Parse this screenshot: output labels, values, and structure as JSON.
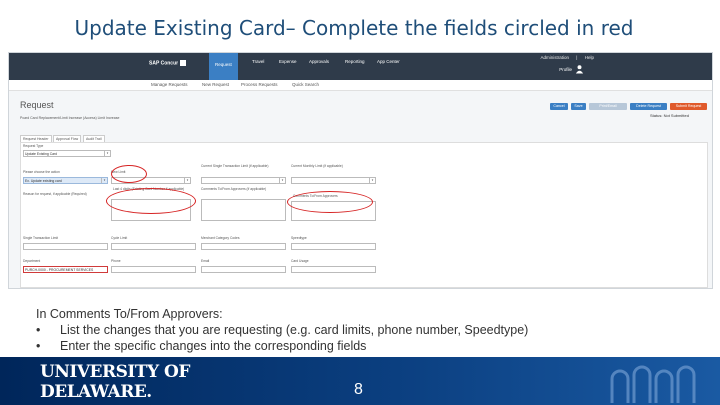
{
  "slide": {
    "title": "Update Existing Card– Complete the fields circled in red",
    "page_number": "8"
  },
  "sap": {
    "util_links": [
      "Administration",
      "|",
      "Help"
    ],
    "profile": "Profile",
    "logo_text": "SAP Concur",
    "nav": [
      "Request",
      "Travel",
      "Expense",
      "Approvals",
      "Reporting",
      "App Center"
    ],
    "subnav": [
      "Manage Requests",
      "New Request",
      "Process Requests",
      "Quick Search"
    ],
    "request_title": "Request",
    "request_sub": "Pcard Card Replacement/Limit Increase (Access) Limit Increase",
    "buttons": [
      {
        "label": "Cancel",
        "color": "#3b7fc4"
      },
      {
        "label": "Save",
        "color": "#3b7fc4"
      },
      {
        "label": "Print/Email",
        "color": "#b7c7d8"
      },
      {
        "label": "Delete Request",
        "color": "#3b7fc4"
      },
      {
        "label": "Submit Request",
        "color": "#e05a2b"
      }
    ],
    "status_label": "Status:",
    "status_value": "Not Submitted",
    "tabs": [
      "Request Header",
      "Approval Flow",
      "Audit Trail"
    ],
    "fields": {
      "request_type_label": "Request Type",
      "request_type_value": "Update Existing Card",
      "action_label": "Please choose the action",
      "action_value": "Ex. Update existing card",
      "limit_label": "New Limit",
      "current_single_label": "Current Single Transaction Limit (if applicable)",
      "current_monthly_label": "Current Monthly Limit (if applicable)",
      "reason_label": "Reason for request, if applicable (Required)",
      "card_number_label": "Last 4 digits (Existing Card Number if applicable)",
      "approver_label": "Comments To/From Approvers (if applicable)",
      "comments_label": "Comments To/From Approvers",
      "single_label": "Single Transaction Limit",
      "monthly_label": "Cycle Limit",
      "mcc_label": "Merchant Category Codes",
      "speedtype_label": "Speedtype",
      "dept_label": "Department",
      "dept_value": "PURCH-0000 - PROCUREMENT SERVICES",
      "phone_label": "Phone",
      "email_label": "Email",
      "usage_label": "Card Usage"
    }
  },
  "comments": {
    "heading": "In Comments To/From Approvers:",
    "bullets": [
      "List the changes that you are requesting (e.g. card limits, phone number, Speedtype)",
      "Enter the specific changes into the corresponding fields"
    ],
    "bullet_symbol": "•"
  },
  "footer": {
    "logo_line1": "UNIVERSITY OF",
    "logo_line2": "DELAWARE."
  }
}
